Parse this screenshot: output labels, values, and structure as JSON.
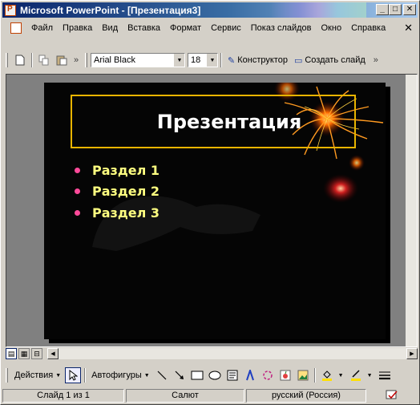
{
  "window": {
    "title": "Microsoft PowerPoint - [Презентация3]",
    "minimize": "_",
    "maximize": "□",
    "close": "✕"
  },
  "menu": {
    "items": [
      "Файл",
      "Правка",
      "Вид",
      "Вставка",
      "Формат",
      "Сервис",
      "Показ слайдов",
      "Окно",
      "Справка"
    ],
    "close_doc": "✕"
  },
  "toolbar": {
    "font_name": "Arial Black",
    "font_size": "18",
    "designer_label": "Конструктор",
    "new_slide_label": "Создать слайд",
    "more_chevron": "»"
  },
  "slide": {
    "title": "Презентация",
    "bullets": [
      "Раздел 1",
      "Раздел 2",
      "Раздел 3"
    ],
    "colors": {
      "background": "#050505",
      "title_border": "#e8b400",
      "bullet_dot": "#ff4a9a",
      "bullet_text": "#ffff80",
      "title_text": "#ffffff"
    }
  },
  "drawing_toolbar": {
    "actions_label": "Действия",
    "autoshapes_label": "Автофигуры"
  },
  "status": {
    "slide_info": "Слайд 1 из 1",
    "design": "Салют",
    "language": "русский (Россия)"
  },
  "icons": {
    "new": "new-document-icon",
    "copy": "copy-icon",
    "paste": "paste-icon",
    "designer": "slide-design-icon",
    "new_slide": "new-slide-icon",
    "select": "pointer-icon",
    "line": "line-icon",
    "arrow": "arrow-icon",
    "rect": "rectangle-icon",
    "oval": "oval-icon",
    "textbox": "textbox-icon",
    "wordart": "wordart-icon",
    "diagram": "diagram-icon",
    "clipart": "clipart-icon",
    "picture": "picture-icon",
    "fill": "fill-color-icon",
    "line_color": "line-color-icon",
    "line_style": "line-style-icon",
    "spelling": "spelling-icon"
  }
}
